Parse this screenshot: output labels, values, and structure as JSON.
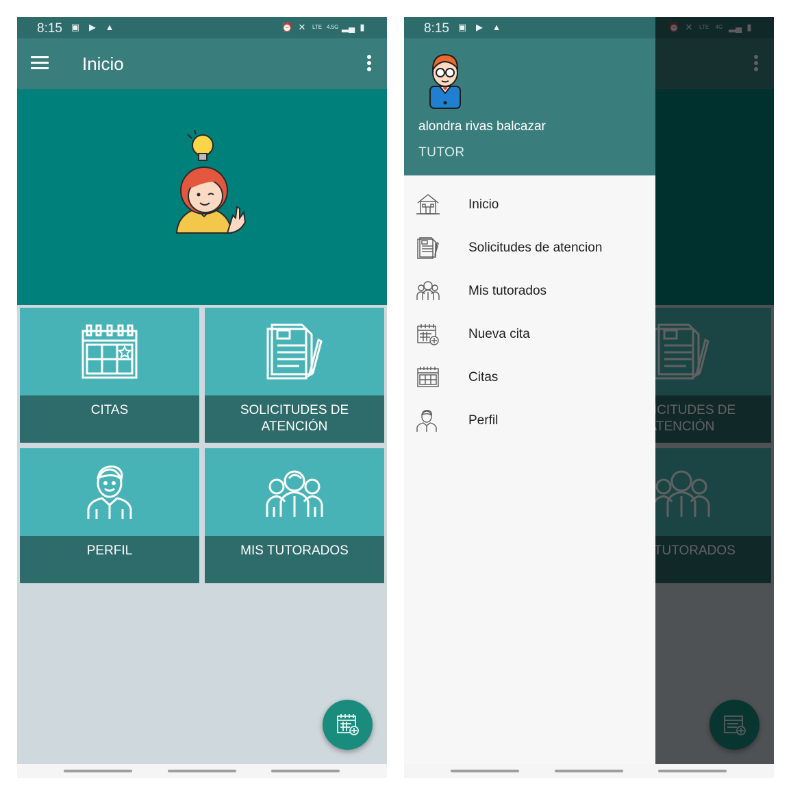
{
  "status_bar": {
    "time": "8:15",
    "network_left": "4.5G",
    "network_right": "4G"
  },
  "colors": {
    "primary": "#3a7d7d",
    "primary_dark": "#2e6b6b",
    "hero": "#00807a",
    "tile": "#48b3b6",
    "fab": "#198c7e"
  },
  "app_bar": {
    "title": "Inicio"
  },
  "tiles": [
    {
      "label": "CITAS",
      "icon": "calendar-star-icon"
    },
    {
      "label": "SOLICITUDES DE ATENCIÓN",
      "icon": "document-pen-icon"
    },
    {
      "label": "PERFIL",
      "icon": "person-icon"
    },
    {
      "label": "MIS TUTORADOS",
      "icon": "group-icon"
    }
  ],
  "fab": {
    "icon": "calendar-add-icon"
  },
  "drawer": {
    "user_name": "alondra rivas balcazar",
    "user_role": "TUTOR",
    "items": [
      {
        "label": "Inicio",
        "icon": "home-icon"
      },
      {
        "label": "Solicitudes de atencion",
        "icon": "document-icon"
      },
      {
        "label": "Mis tutorados",
        "icon": "group-icon"
      },
      {
        "label": "Nueva cita",
        "icon": "calendar-add-icon"
      },
      {
        "label": "Citas",
        "icon": "calendar-icon"
      },
      {
        "label": "Perfil",
        "icon": "person-icon"
      }
    ]
  }
}
